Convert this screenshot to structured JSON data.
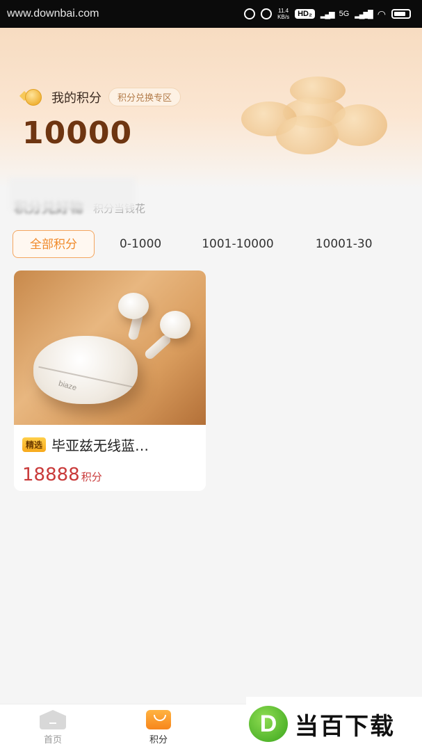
{
  "status_bar": {
    "watermark": "www.downbai.com",
    "speed_value": "11.4",
    "speed_unit": "KB/s",
    "hd": "HD₂",
    "network": "5G"
  },
  "header": {
    "points_label": "我的积分",
    "exchange_label": "积分兑换专区",
    "points_value": "10000"
  },
  "section": {
    "title": "积分兑好物",
    "subtitle": "积分当钱花"
  },
  "filters": {
    "tabs": [
      {
        "label": "全部积分"
      },
      {
        "label": "0-1000"
      },
      {
        "label": "1001-10000"
      },
      {
        "label": "10001-30"
      }
    ],
    "selected": "全部积分"
  },
  "products": [
    {
      "badge": "精选",
      "title": "毕亚兹无线蓝…",
      "image_brand": "biaze",
      "price": "18888",
      "price_unit": "积分"
    }
  ],
  "bottom_nav": {
    "items": [
      {
        "label": "首页",
        "icon": "home-icon"
      },
      {
        "label": "积分",
        "icon": "shopping-bag-icon"
      }
    ]
  },
  "watermark_bottom": {
    "logo_letter": "D",
    "text": "当百下载"
  },
  "colors": {
    "accent": "#f08a2a",
    "price": "#c93a3a",
    "points": "#6e3511"
  }
}
